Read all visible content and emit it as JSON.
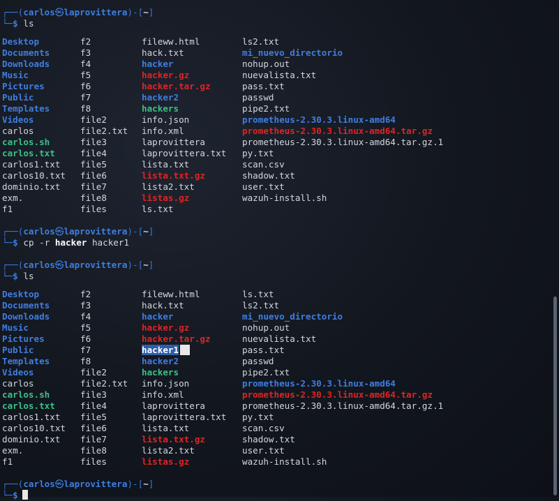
{
  "prompt": {
    "top_open": "┌──(",
    "user": "carlos",
    "at": "㉿",
    "host": "laprovittera",
    "mid": ")-[",
    "dir": "~",
    "close": "]",
    "bottom": "└─",
    "dollar": "$"
  },
  "commands": {
    "ls1": "ls",
    "cp_pre": "cp -r ",
    "cp_src": "hacker",
    "cp_dst": " hacker1",
    "ls2": "ls"
  },
  "colors": {
    "directory": "#3f7ee0",
    "archive": "#e02424",
    "executable": "#3bc087",
    "text": "#d4d7dd",
    "selection": "#2f5ea8"
  },
  "listing1": [
    [
      {
        "t": "Desktop",
        "k": "dir"
      },
      {
        "t": "f2",
        "k": "file"
      },
      {
        "t": "fileww.html",
        "k": "file"
      },
      {
        "t": "ls2.txt",
        "k": "file"
      }
    ],
    [
      {
        "t": "Documents",
        "k": "dir"
      },
      {
        "t": "f3",
        "k": "file"
      },
      {
        "t": "hack.txt",
        "k": "file"
      },
      {
        "t": "mi_nuevo_directorio",
        "k": "dir"
      }
    ],
    [
      {
        "t": "Downloads",
        "k": "dir"
      },
      {
        "t": "f4",
        "k": "file"
      },
      {
        "t": "hacker",
        "k": "dir"
      },
      {
        "t": "nohup.out",
        "k": "file"
      }
    ],
    [
      {
        "t": "Music",
        "k": "dir"
      },
      {
        "t": "f5",
        "k": "file"
      },
      {
        "t": "hacker.gz",
        "k": "arch"
      },
      {
        "t": "nuevalista.txt",
        "k": "file"
      }
    ],
    [
      {
        "t": "Pictures",
        "k": "dir"
      },
      {
        "t": "f6",
        "k": "file"
      },
      {
        "t": "hacker.tar.gz",
        "k": "arch"
      },
      {
        "t": "pass.txt",
        "k": "file"
      }
    ],
    [
      {
        "t": "Public",
        "k": "dir"
      },
      {
        "t": "f7",
        "k": "file"
      },
      {
        "t": "hacker2",
        "k": "dir"
      },
      {
        "t": "passwd",
        "k": "file"
      }
    ],
    [
      {
        "t": "Templates",
        "k": "dir"
      },
      {
        "t": "f8",
        "k": "file"
      },
      {
        "t": "hackers",
        "k": "exec"
      },
      {
        "t": "pipe2.txt",
        "k": "file"
      }
    ],
    [
      {
        "t": "Videos",
        "k": "dir"
      },
      {
        "t": "file2",
        "k": "file"
      },
      {
        "t": "info.json",
        "k": "file"
      },
      {
        "t": "prometheus-2.30.3.linux-amd64",
        "k": "dir"
      }
    ],
    [
      {
        "t": "carlos",
        "k": "file"
      },
      {
        "t": "file2.txt",
        "k": "file"
      },
      {
        "t": "info.xml",
        "k": "file"
      },
      {
        "t": "prometheus-2.30.3.linux-amd64.tar.gz",
        "k": "arch"
      }
    ],
    [
      {
        "t": "carlos.sh",
        "k": "exec"
      },
      {
        "t": "file3",
        "k": "file"
      },
      {
        "t": "laprovittera",
        "k": "file"
      },
      {
        "t": "prometheus-2.30.3.linux-amd64.tar.gz.1",
        "k": "file"
      }
    ],
    [
      {
        "t": "carlos.txt",
        "k": "exec"
      },
      {
        "t": "file4",
        "k": "file"
      },
      {
        "t": "laprovittera.txt",
        "k": "file"
      },
      {
        "t": "py.txt",
        "k": "file"
      }
    ],
    [
      {
        "t": "carlos1.txt",
        "k": "file"
      },
      {
        "t": "file5",
        "k": "file"
      },
      {
        "t": "lista.txt",
        "k": "file"
      },
      {
        "t": "scan.csv",
        "k": "file"
      }
    ],
    [
      {
        "t": "carlos10.txt",
        "k": "file"
      },
      {
        "t": "file6",
        "k": "file"
      },
      {
        "t": "lista.txt.gz",
        "k": "arch"
      },
      {
        "t": "shadow.txt",
        "k": "file"
      }
    ],
    [
      {
        "t": "dominio.txt",
        "k": "file"
      },
      {
        "t": "file7",
        "k": "file"
      },
      {
        "t": "lista2.txt",
        "k": "file"
      },
      {
        "t": "user.txt",
        "k": "file"
      }
    ],
    [
      {
        "t": "exm.",
        "k": "file"
      },
      {
        "t": "file8",
        "k": "file"
      },
      {
        "t": "listas.gz",
        "k": "arch"
      },
      {
        "t": "wazuh-install.sh",
        "k": "file"
      }
    ],
    [
      {
        "t": "f1",
        "k": "file"
      },
      {
        "t": "files",
        "k": "file"
      },
      {
        "t": "ls.txt",
        "k": "file"
      },
      {
        "t": "",
        "k": "file"
      }
    ]
  ],
  "listing2": [
    [
      {
        "t": "Desktop",
        "k": "dir"
      },
      {
        "t": "f2",
        "k": "file"
      },
      {
        "t": "fileww.html",
        "k": "file"
      },
      {
        "t": "ls.txt",
        "k": "file"
      }
    ],
    [
      {
        "t": "Documents",
        "k": "dir"
      },
      {
        "t": "f3",
        "k": "file"
      },
      {
        "t": "hack.txt",
        "k": "file"
      },
      {
        "t": "ls2.txt",
        "k": "file"
      }
    ],
    [
      {
        "t": "Downloads",
        "k": "dir"
      },
      {
        "t": "f4",
        "k": "file"
      },
      {
        "t": "hacker",
        "k": "dir"
      },
      {
        "t": "mi_nuevo_directorio",
        "k": "dir"
      }
    ],
    [
      {
        "t": "Music",
        "k": "dir"
      },
      {
        "t": "f5",
        "k": "file"
      },
      {
        "t": "hacker.gz",
        "k": "arch"
      },
      {
        "t": "nohup.out",
        "k": "file"
      }
    ],
    [
      {
        "t": "Pictures",
        "k": "dir"
      },
      {
        "t": "f6",
        "k": "file"
      },
      {
        "t": "hacker.tar.gz",
        "k": "arch"
      },
      {
        "t": "nuevalista.txt",
        "k": "file"
      }
    ],
    [
      {
        "t": "Public",
        "k": "dir"
      },
      {
        "t": "f7",
        "k": "file"
      },
      {
        "t": "hacker1",
        "k": "sel"
      },
      {
        "t": "pass.txt",
        "k": "file"
      }
    ],
    [
      {
        "t": "Templates",
        "k": "dir"
      },
      {
        "t": "f8",
        "k": "file"
      },
      {
        "t": "hacker2",
        "k": "dir"
      },
      {
        "t": "passwd",
        "k": "file"
      }
    ],
    [
      {
        "t": "Videos",
        "k": "dir"
      },
      {
        "t": "file2",
        "k": "file"
      },
      {
        "t": "hackers",
        "k": "exec"
      },
      {
        "t": "pipe2.txt",
        "k": "file"
      }
    ],
    [
      {
        "t": "carlos",
        "k": "file"
      },
      {
        "t": "file2.txt",
        "k": "file"
      },
      {
        "t": "info.json",
        "k": "file"
      },
      {
        "t": "prometheus-2.30.3.linux-amd64",
        "k": "dir"
      }
    ],
    [
      {
        "t": "carlos.sh",
        "k": "exec"
      },
      {
        "t": "file3",
        "k": "file"
      },
      {
        "t": "info.xml",
        "k": "file"
      },
      {
        "t": "prometheus-2.30.3.linux-amd64.tar.gz",
        "k": "arch"
      }
    ],
    [
      {
        "t": "carlos.txt",
        "k": "exec"
      },
      {
        "t": "file4",
        "k": "file"
      },
      {
        "t": "laprovittera",
        "k": "file"
      },
      {
        "t": "prometheus-2.30.3.linux-amd64.tar.gz.1",
        "k": "file"
      }
    ],
    [
      {
        "t": "carlos1.txt",
        "k": "file"
      },
      {
        "t": "file5",
        "k": "file"
      },
      {
        "t": "laprovittera.txt",
        "k": "file"
      },
      {
        "t": "py.txt",
        "k": "file"
      }
    ],
    [
      {
        "t": "carlos10.txt",
        "k": "file"
      },
      {
        "t": "file6",
        "k": "file"
      },
      {
        "t": "lista.txt",
        "k": "file"
      },
      {
        "t": "scan.csv",
        "k": "file"
      }
    ],
    [
      {
        "t": "dominio.txt",
        "k": "file"
      },
      {
        "t": "file7",
        "k": "file"
      },
      {
        "t": "lista.txt.gz",
        "k": "arch"
      },
      {
        "t": "shadow.txt",
        "k": "file"
      }
    ],
    [
      {
        "t": "exm.",
        "k": "file"
      },
      {
        "t": "file8",
        "k": "file"
      },
      {
        "t": "lista2.txt",
        "k": "file"
      },
      {
        "t": "user.txt",
        "k": "file"
      }
    ],
    [
      {
        "t": "f1",
        "k": "file"
      },
      {
        "t": "files",
        "k": "file"
      },
      {
        "t": "listas.gz",
        "k": "arch"
      },
      {
        "t": "wazuh-install.sh",
        "k": "file"
      }
    ]
  ]
}
